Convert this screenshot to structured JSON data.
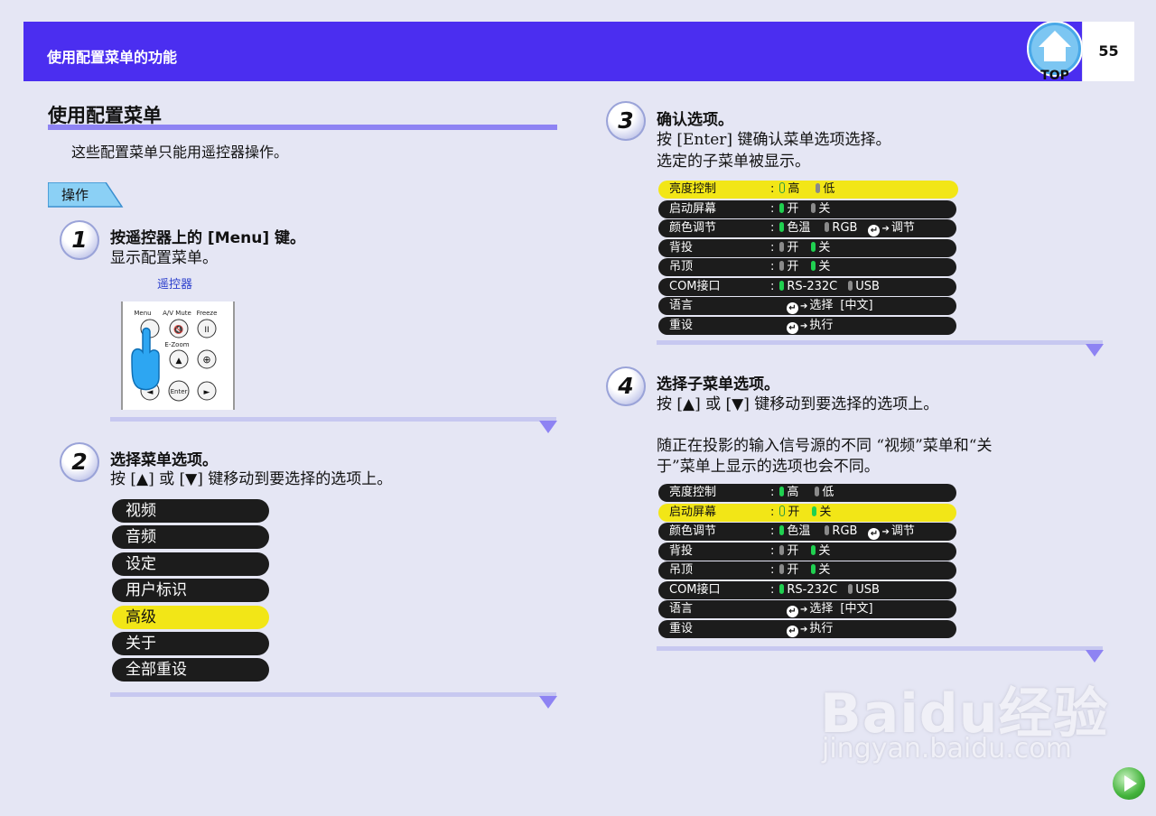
{
  "header": {
    "title": "使用配置菜单的功能",
    "page_number": "55",
    "top_label": "TOP"
  },
  "section": {
    "title": "使用配置菜单",
    "intro": "这些配置菜单只能用遥控器操作。",
    "op_label": "操作"
  },
  "steps": [
    {
      "num": "1",
      "title": "按遥控器上的 [Menu] 键。",
      "lines": [
        "显示配置菜单。"
      ]
    },
    {
      "num": "2",
      "title": "选择菜单选项。",
      "lines": [
        "按 [▲] 或 [▼] 键移动到要选择的选项上。"
      ]
    },
    {
      "num": "3",
      "title": "确认选项。",
      "lines": [
        "按 [Enter] 键确认菜单选项选择。",
        "选定的子菜单被显示。"
      ]
    },
    {
      "num": "4",
      "title": "选择子菜单选项。",
      "lines": [
        "按 [▲] 或 [▼] 键移动到要选择的选项上。",
        "随正在投影的输入信号源的不同 “视频”菜单和“关",
        "于”菜单上显示的选项也会不同。"
      ]
    }
  ],
  "remote": {
    "label": "遥控器",
    "buttons": [
      "Menu",
      "A/V Mute",
      "Freeze",
      "E-Zoom",
      "Enter"
    ]
  },
  "menu_items": [
    "视频",
    "音频",
    "设定",
    "用户标识",
    "高级",
    "关于",
    "全部重设"
  ],
  "menu_selected_index": 4,
  "settings": {
    "rows": [
      {
        "label": "亮度控制",
        "value": [
          "高",
          "低"
        ]
      },
      {
        "label": "启动屏幕",
        "value": [
          "开",
          "关"
        ]
      },
      {
        "label": "颜色调节",
        "value": [
          "色温",
          "RGB",
          "调节"
        ]
      },
      {
        "label": "背投",
        "value": [
          "开",
          "关"
        ]
      },
      {
        "label": "吊顶",
        "value": [
          "开",
          "关"
        ]
      },
      {
        "label": "COM接口",
        "value": [
          "RS-232C",
          "USB"
        ]
      },
      {
        "label": "语言",
        "value": [
          "选择",
          "[中文]"
        ]
      },
      {
        "label": "重设",
        "value": [
          "执行"
        ]
      }
    ],
    "colon": ":",
    "table1_selected": 0,
    "table2_selected": 1
  },
  "watermark": {
    "main": "Baidu经验",
    "sub": "jingyan.baidu.com"
  },
  "colors": {
    "header": "#4b2ef0",
    "highlight": "#f2e617",
    "row": "#1c1c1c",
    "rule": "#8e83f3"
  }
}
